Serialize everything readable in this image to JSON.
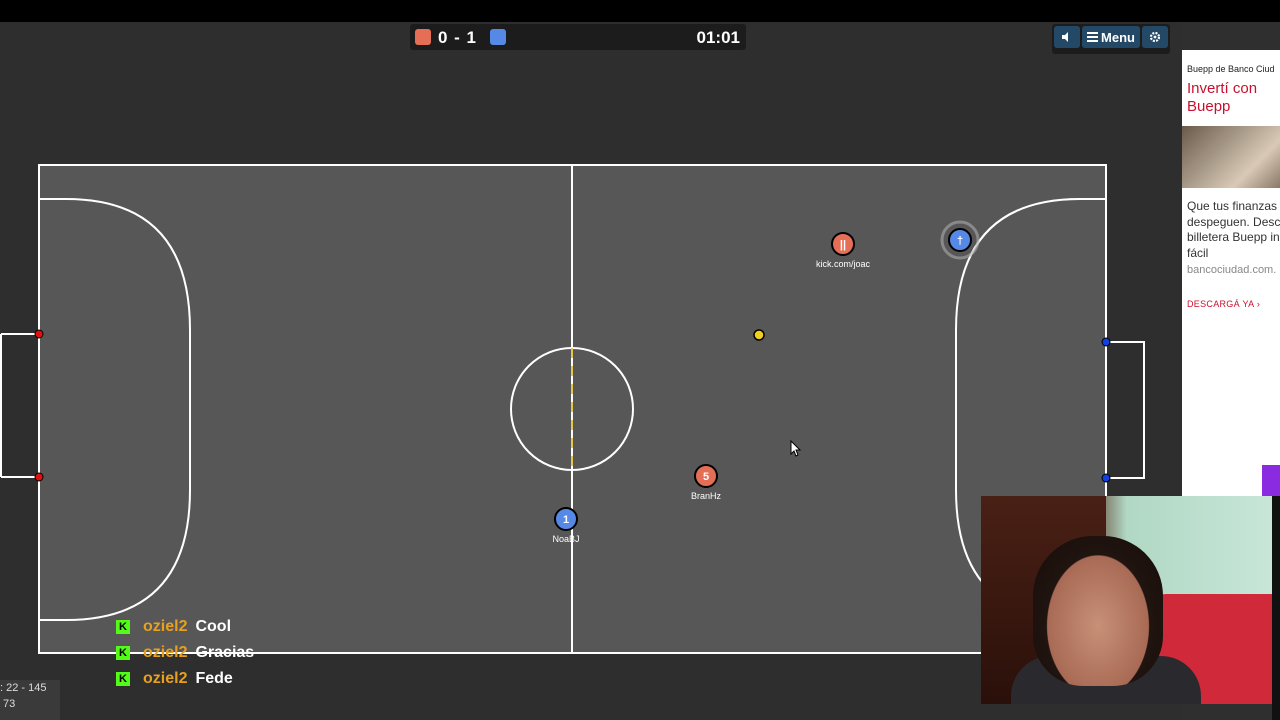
{
  "scoreboard": {
    "score": "0 - 1",
    "time": "01:01",
    "red_color": "#e56e56",
    "blue_color": "#5689e5"
  },
  "controls": {
    "sound_icon": "speaker-icon",
    "menu_label": "Menu",
    "settings_icon": "gear-icon"
  },
  "players": [
    {
      "team": "red",
      "number": "5",
      "name": "BranHz"
    },
    {
      "team": "red",
      "number": "||",
      "name": "kick.com/joac"
    },
    {
      "team": "blue",
      "number": "1",
      "name": "NoaBJ"
    },
    {
      "team": "blue",
      "number": "†",
      "name": ""
    }
  ],
  "chat": [
    {
      "user": "oziel2",
      "message": "Cool"
    },
    {
      "user": "oziel2",
      "message": "Gracias"
    },
    {
      "user": "oziel2",
      "message": "Fede"
    }
  ],
  "stats": {
    "line1": ": 22 - 145",
    "line2": "73"
  },
  "ad": {
    "brand": "Buepp de Banco Ciud",
    "headline": "Invertí con Buepp",
    "body": "Que tus finanzas despeguen. Desca la billetera Buepp invertí fácil",
    "url": "bancociudad.com.",
    "cta": "DESCARGÁ YA"
  }
}
